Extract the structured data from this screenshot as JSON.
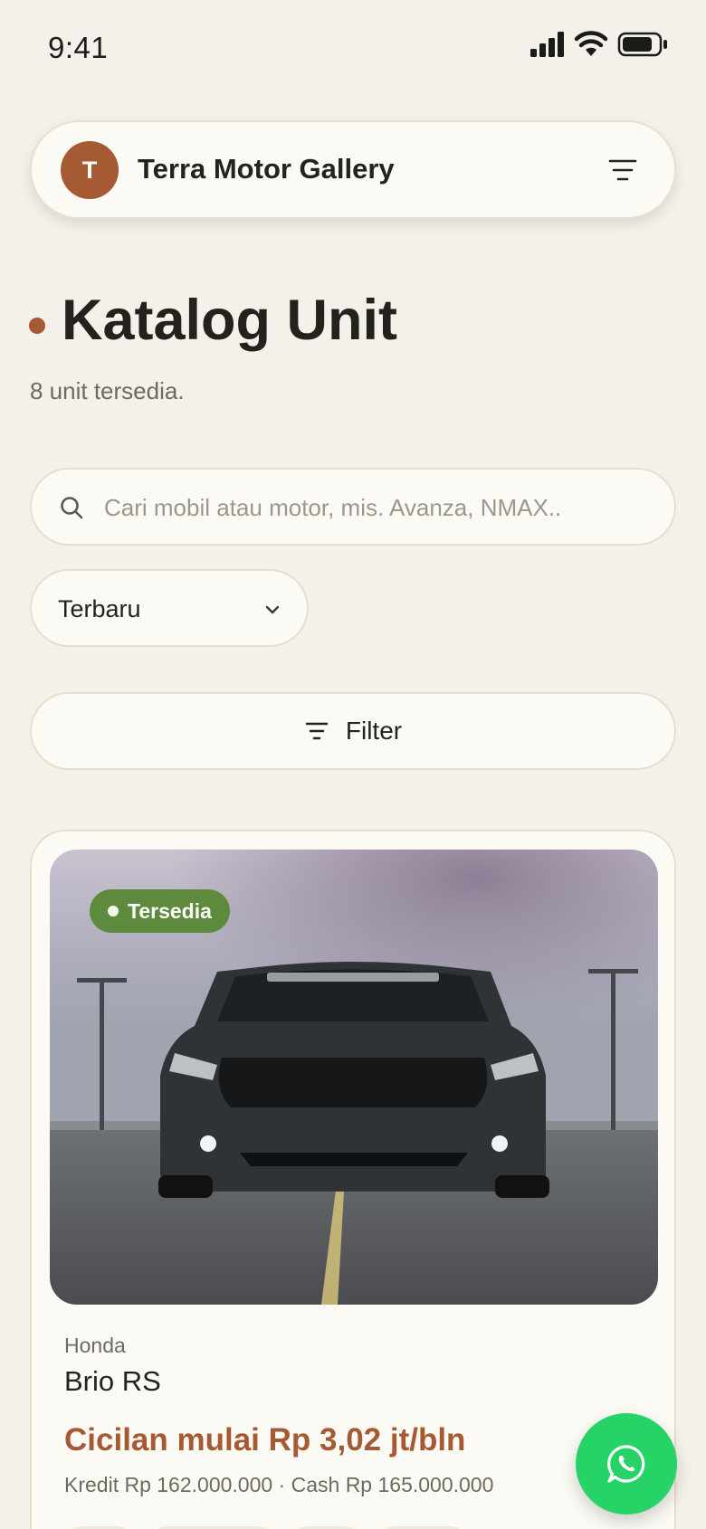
{
  "status_bar": {
    "time": "9:41"
  },
  "header": {
    "avatar_initial": "T",
    "brand_name": "Terra Motor Gallery"
  },
  "page": {
    "title": "Katalog Unit",
    "subtitle": "8 unit tersedia."
  },
  "search": {
    "placeholder": "Cari mobil atau motor, mis. Avanza, NMAX.."
  },
  "sort": {
    "selected": "Terbaru"
  },
  "filter": {
    "label": "Filter"
  },
  "listing": {
    "badge": "Tersedia",
    "brand": "Honda",
    "model": "Brio RS",
    "installment": "Cicilan mulai Rp 3,02 jt/bln",
    "prices": "Kredit Rp 162.000.000 · Cash Rp 165.000.000"
  },
  "colors": {
    "accent": "#a65a34",
    "background": "#f3f1ea",
    "available_badge": "#5d8a3c",
    "whatsapp": "#26d366"
  },
  "icons": [
    "signal-icon",
    "wifi-icon",
    "battery-icon",
    "menu-icon",
    "search-icon",
    "chevron-down-icon",
    "filter-icon",
    "whatsapp-icon"
  ]
}
